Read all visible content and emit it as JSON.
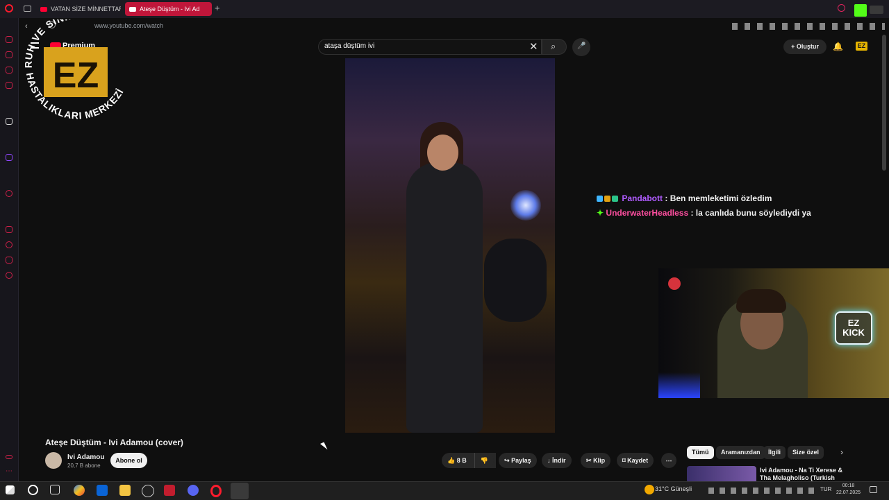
{
  "browser": {
    "tabs": [
      {
        "label": "VATAN SİZE MİNNETTAR"
      },
      {
        "label": "Ateşe Düştüm - Ivi Ad"
      }
    ],
    "new_tab": "+",
    "url": "www.youtube.com/watch"
  },
  "header": {
    "logo_label": "Premium",
    "search_value": "ataşa düştüm ivi",
    "clear_glyph": "✕",
    "search_glyph": "⌕",
    "mic_glyph": "🎤",
    "create_label": "+ Oluştur",
    "bell_glyph": "🔔",
    "avatar_label": "EZ"
  },
  "overlay": {
    "watermark_top": "RUH VE SİNİR",
    "watermark_bottom": "HASTALIKLARI MERKEZİ",
    "watermark_logo": "EZ",
    "chat": [
      {
        "user": "Pandabott",
        "sep": " : ",
        "text": "Ben memleketimi özledim",
        "color": "#b05cff"
      },
      {
        "user": "UnderwaterHeadless",
        "sep": " : ",
        "text": "la canlıda bunu söylediydi ya",
        "color": "#ff4fa0"
      }
    ],
    "cam_logo_line1": "EZ",
    "cam_logo_line2": "KICK"
  },
  "video": {
    "title": "Ateşe Düştüm - Ivi Adamou (cover)",
    "channel": "Ivi Adamou",
    "subscribers": "20,7 B abone",
    "subscribe_label": "Abone ol",
    "likes": "8 B",
    "actions": {
      "share": "Paylaş",
      "download": "İndir",
      "clip": "Klip",
      "save": "Kaydet",
      "more": "⋯"
    }
  },
  "related": {
    "chips": [
      "Tümü",
      "Aramanızdan",
      "İlgili",
      "Size özel"
    ],
    "next_glyph": "›",
    "first_title": "Ivi Adamou - Na Ti Xerese & Tha Melagholiso (Turkish Subtitled)"
  },
  "taskbar": {
    "temperature": "31°C",
    "weather": "Güneşli",
    "lang": "TUR",
    "time": "00:18",
    "date": "22.07.2025"
  },
  "colors": {
    "accent": "#ff0033",
    "tab_active": "#c0163a",
    "sidebar_icon": "#d1204a"
  }
}
